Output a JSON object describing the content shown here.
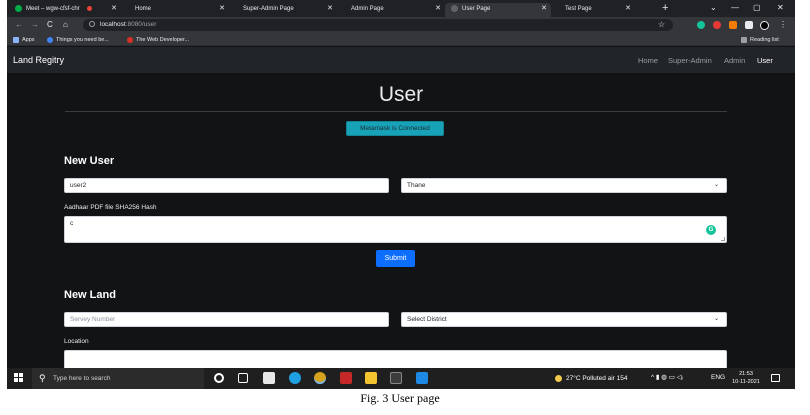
{
  "browser": {
    "tabs": [
      {
        "title": "Meet – wgw-cfsf-chr"
      },
      {
        "title": "Home"
      },
      {
        "title": "Super-Admin Page"
      },
      {
        "title": "Admin Page"
      },
      {
        "title": "User Page",
        "active": true
      },
      {
        "title": "Test Page"
      }
    ],
    "new_tab_label": "+",
    "window_controls": {
      "dropdown": "⌄",
      "minimize": "—",
      "maximize": "▢",
      "close": "✕"
    },
    "url_host": "localhost",
    "url_path": ":8080/user",
    "bookmarks": [
      "Apps",
      "Things you need be...",
      "The Web Developer..."
    ],
    "reading_list": "Reading list"
  },
  "navbar": {
    "brand": "Land Regitry",
    "links": [
      "Home",
      "Super-Admin",
      "Admin",
      "User"
    ],
    "active_link": "User"
  },
  "page": {
    "title": "User",
    "metamask_status": "Metamask is Connected",
    "new_user": {
      "heading": "New User",
      "name_value": "user2",
      "district_value": "Thane",
      "hash_label": "Aadhaar PDF file SHA256 Hash",
      "hash_value": "c",
      "submit_label": "Submit"
    },
    "new_land": {
      "heading": "New Land",
      "survey_placeholder": "Servey Number",
      "district_placeholder": "Select District",
      "location_label": "Location"
    }
  },
  "taskbar": {
    "search_placeholder": "Type here to search",
    "weather": "27°C  Polluted air 154",
    "language": "ENG",
    "time": "21:53",
    "date": "10-11-2021"
  },
  "caption": "Fig. 3 User page"
}
